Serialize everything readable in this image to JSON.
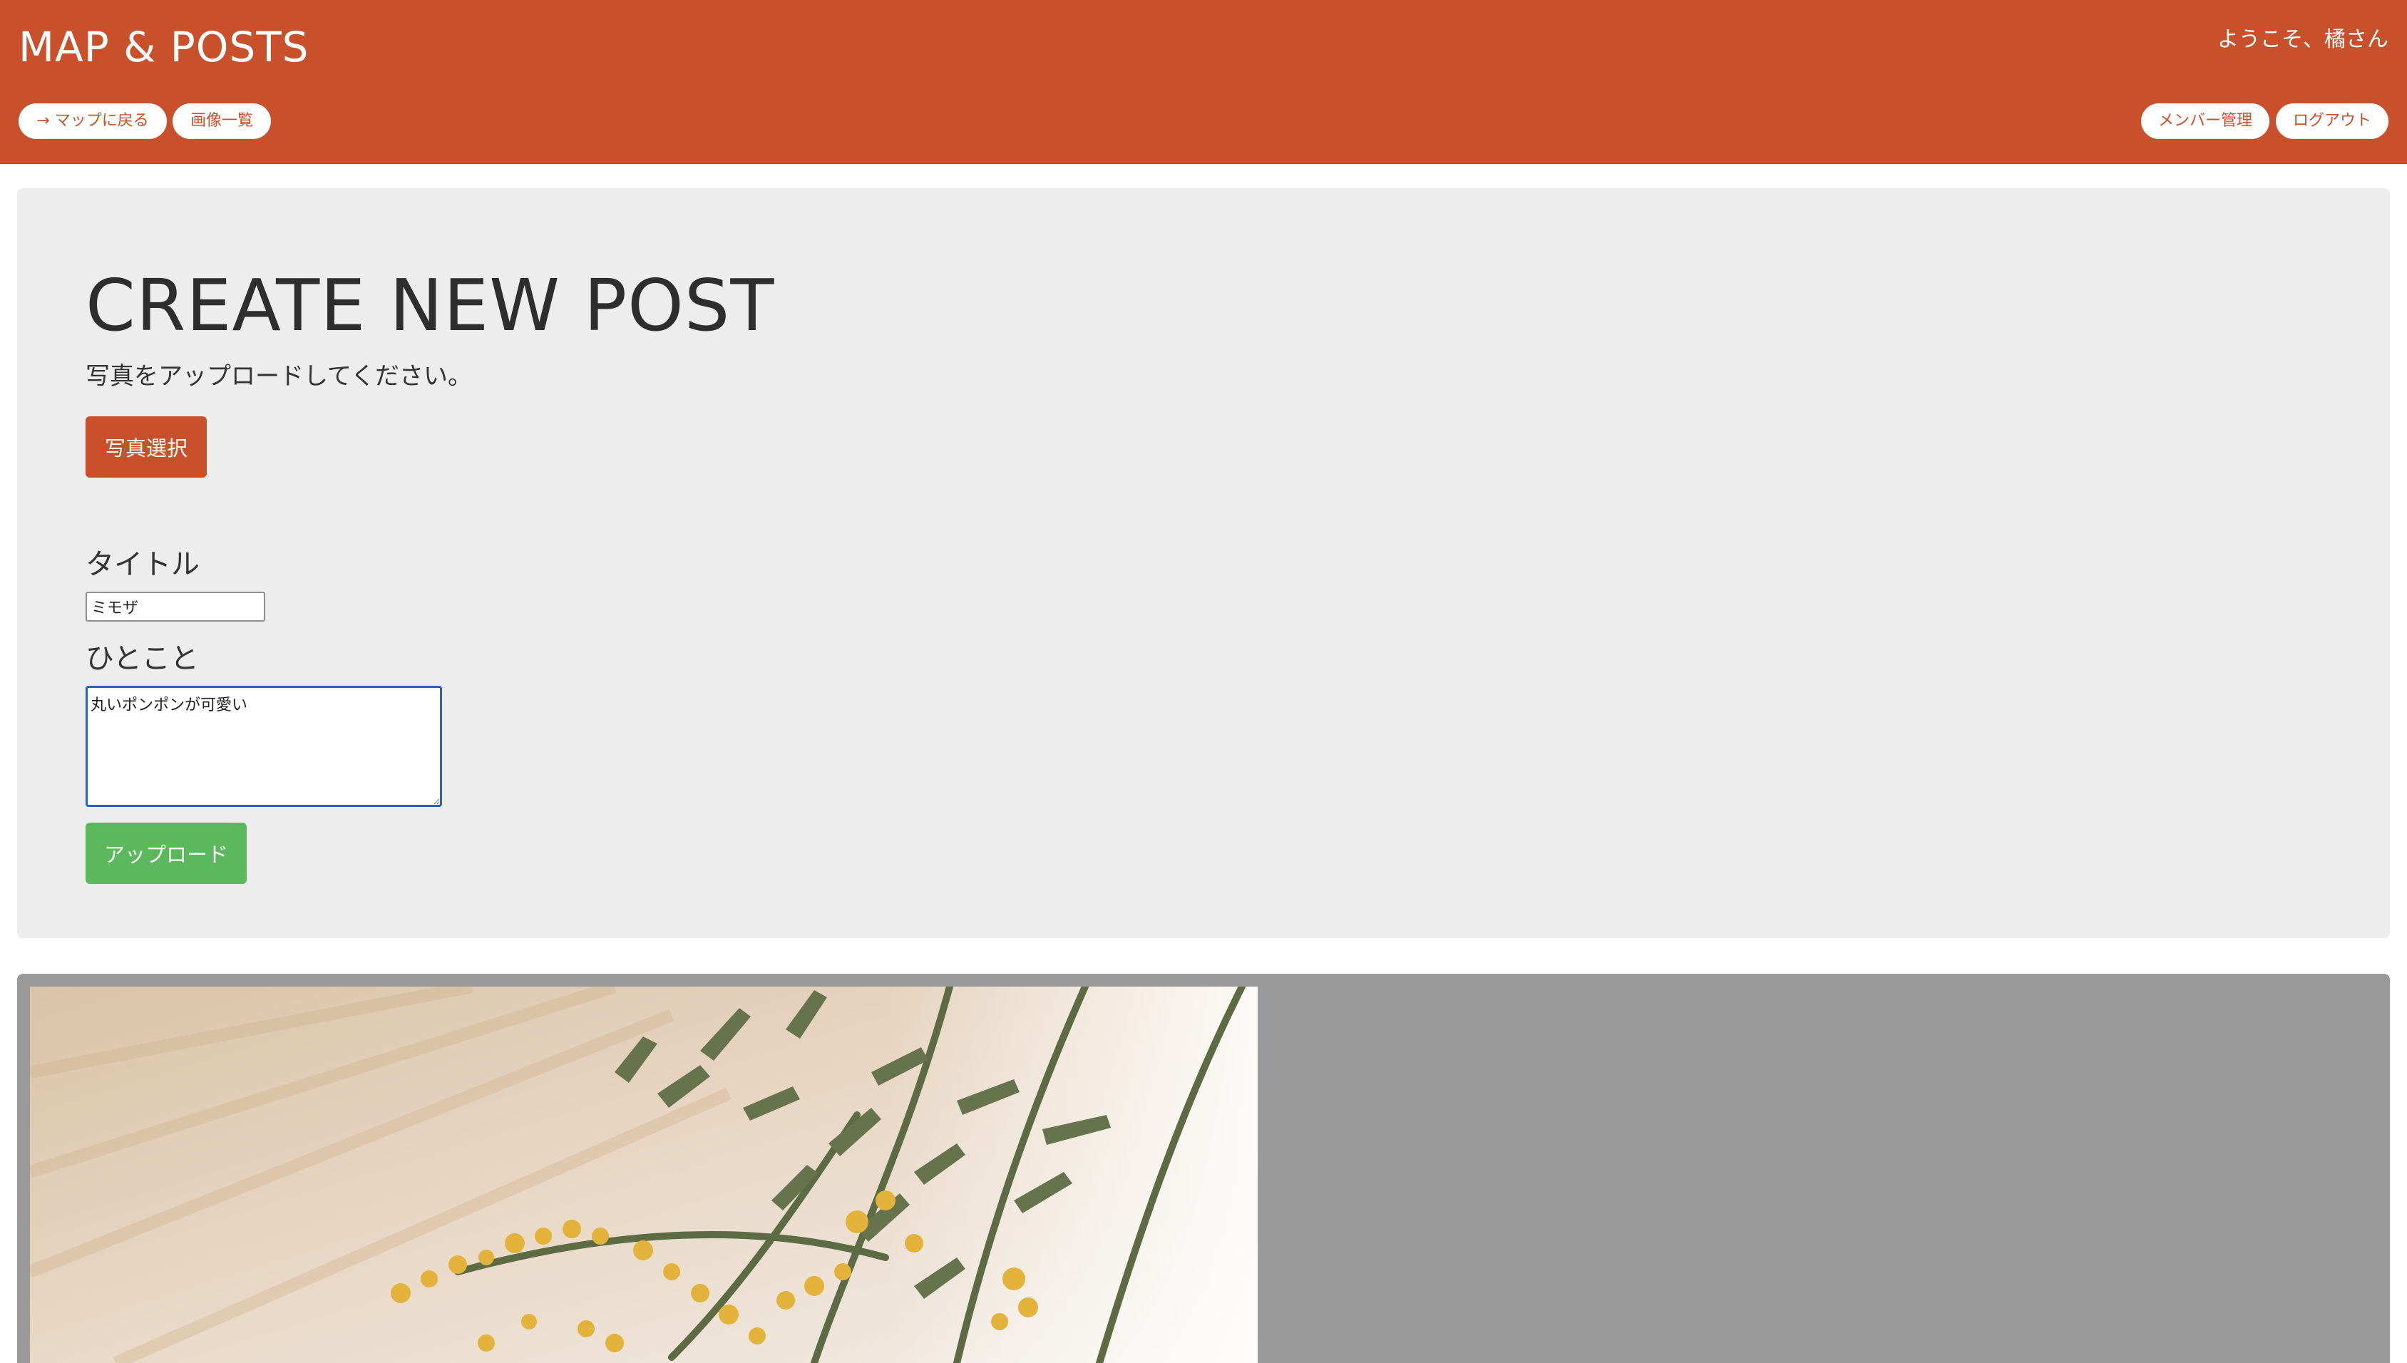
{
  "header": {
    "brand": "MAP & POSTS",
    "welcome": "ようこそ、橘さん",
    "back_label": "→ マップに戻る",
    "gallery_label": "画像一覧",
    "members_label": "メンバー管理",
    "logout_label": "ログアウト"
  },
  "form": {
    "page_title": "CREATE NEW POST",
    "instruction": "写真をアップロードしてください。",
    "select_photo_label": "写真選択",
    "title_label": "タイトル",
    "title_value": "ミモザ",
    "comment_label": "ひとこと",
    "comment_value": "丸いポンポンが可愛い",
    "upload_label": "アップロード"
  },
  "preview": {
    "image_subject": "mimosa-photo"
  },
  "colors": {
    "brand": "#c8502a",
    "panel": "#ededed",
    "upload": "#5cb85c",
    "preview_bg": "#9a9a9a"
  }
}
